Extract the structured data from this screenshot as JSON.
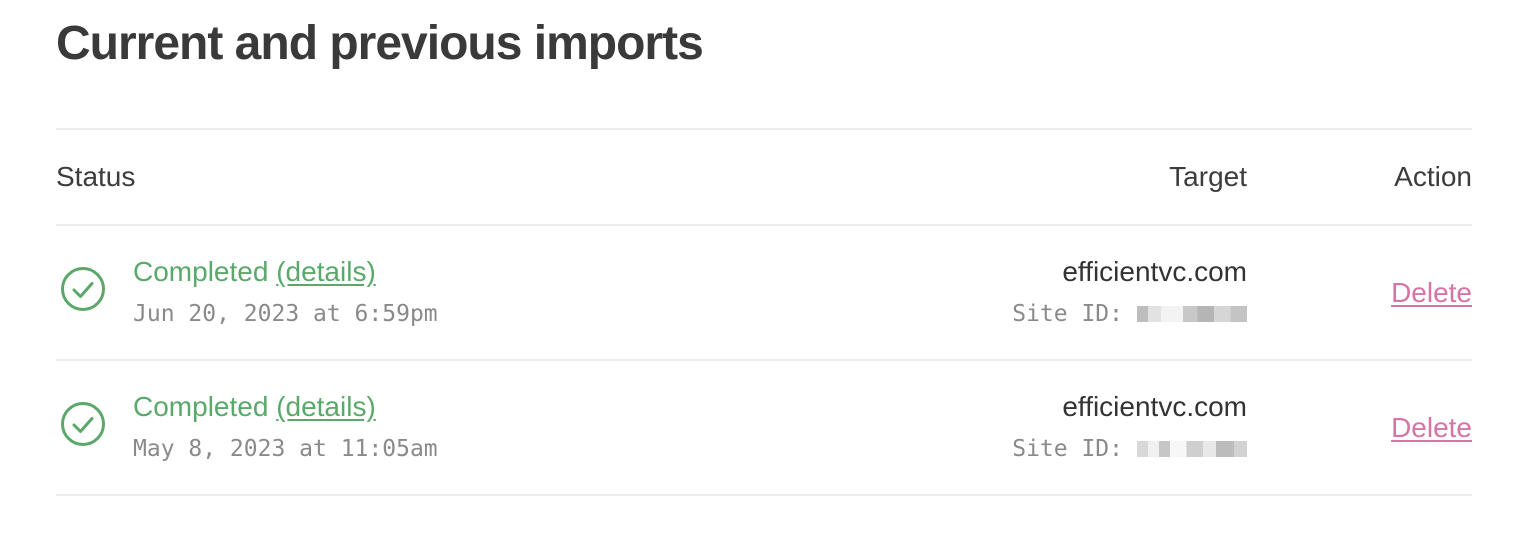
{
  "title": "Current and previous imports",
  "columns": {
    "status": "Status",
    "target": "Target",
    "action": "Action"
  },
  "rows": [
    {
      "status": "Completed",
      "details_label": "(details)",
      "timestamp": "Jun 20, 2023 at 6:59pm",
      "target": "efficientvc.com",
      "site_id_label": "Site ID:",
      "action": "Delete"
    },
    {
      "status": "Completed",
      "details_label": "(details)",
      "timestamp": "May 8, 2023 at 11:05am",
      "target": "efficientvc.com",
      "site_id_label": "Site ID:",
      "action": "Delete"
    }
  ],
  "colors": {
    "success": "#5aa86a",
    "danger_link": "#d574a5",
    "muted": "#8a8a8a"
  },
  "icons": {
    "status": "check-circle-icon"
  }
}
